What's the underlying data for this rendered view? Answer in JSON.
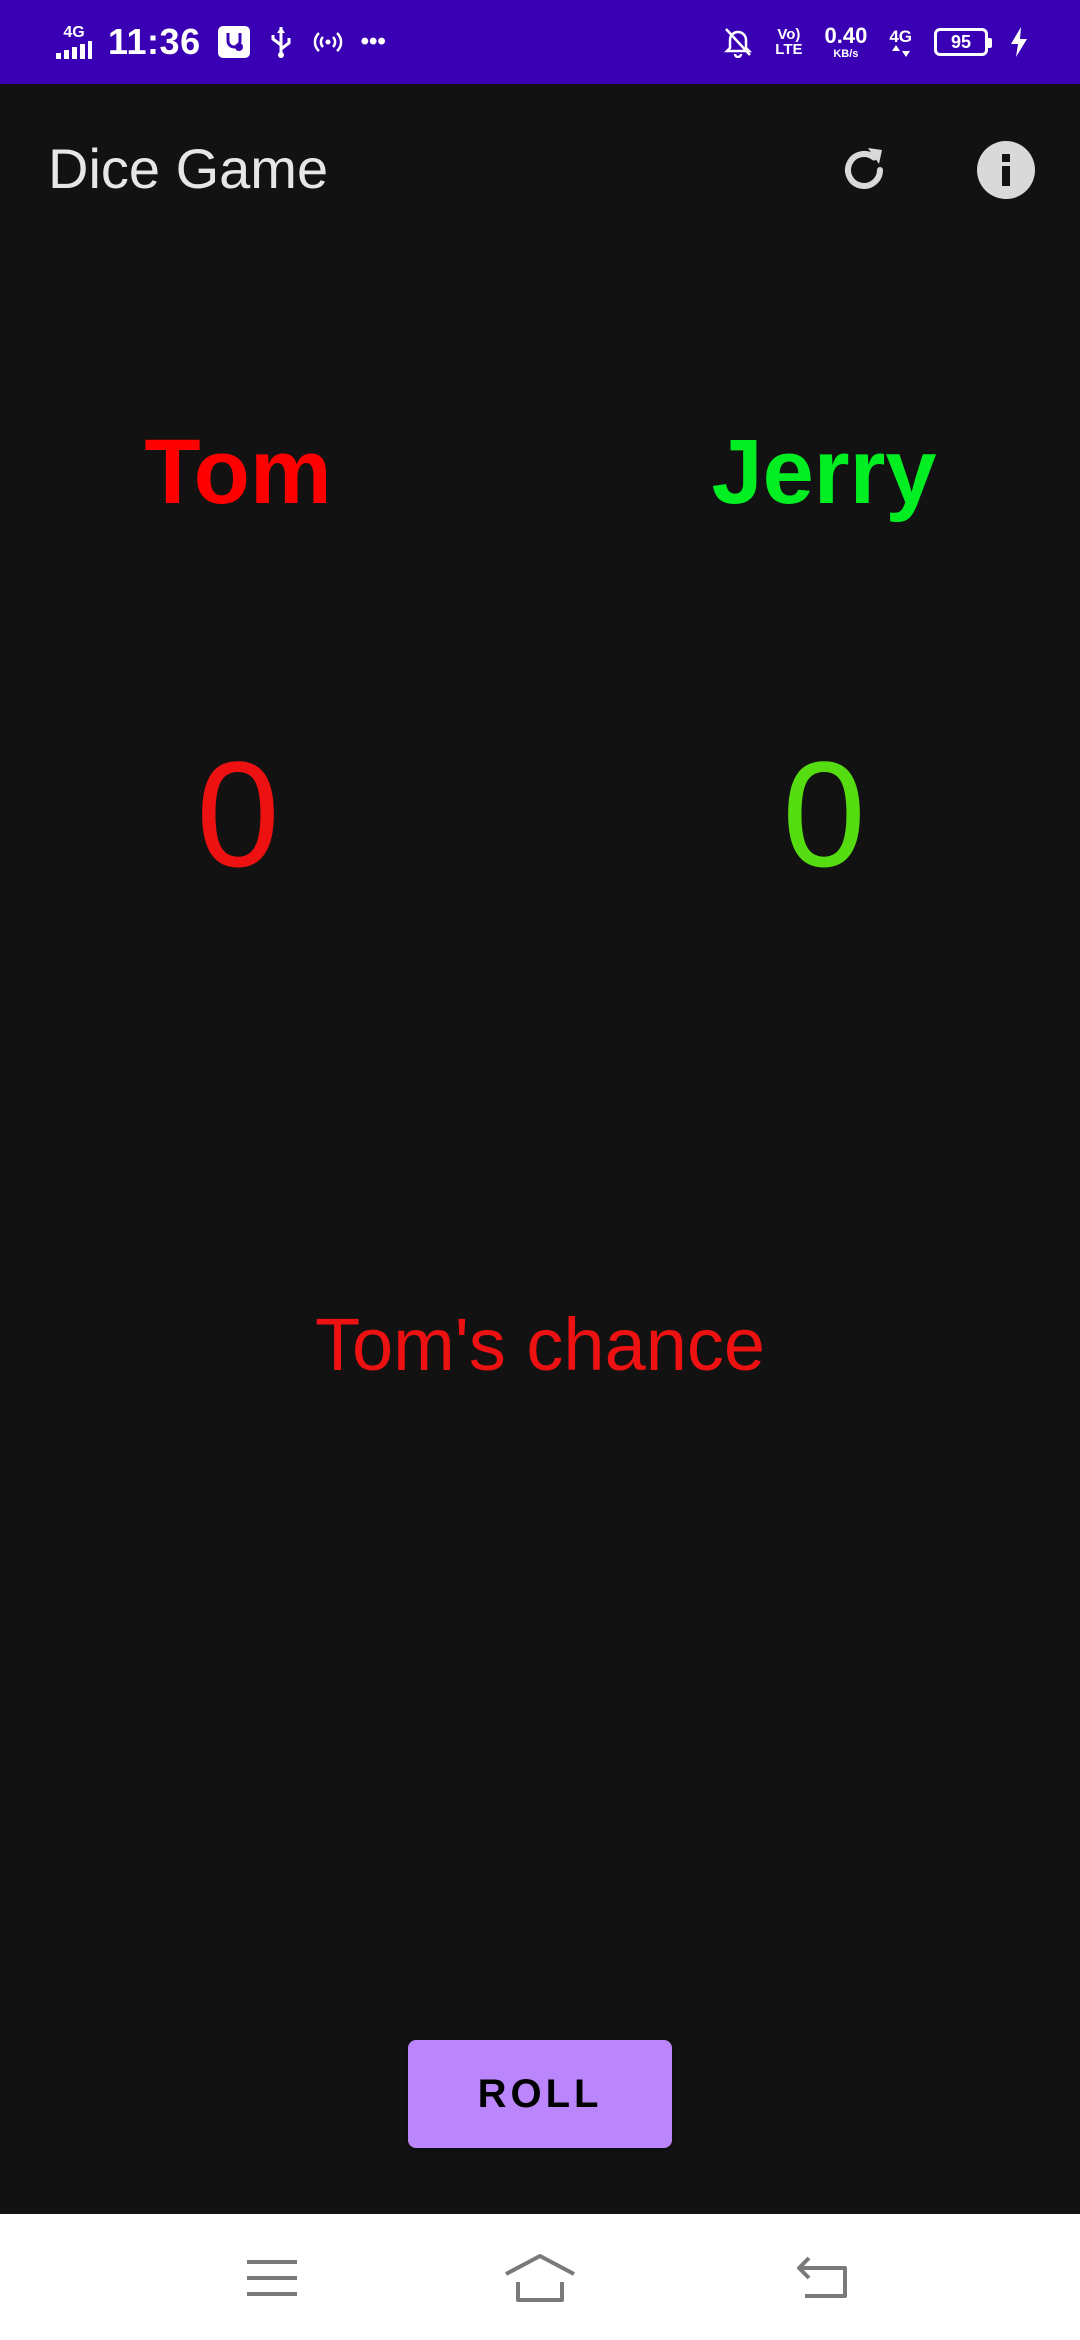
{
  "status_bar": {
    "network_left": "4G",
    "time": "11:36",
    "overflow": "•••",
    "volte_top": "Vo)",
    "volte_bottom": "LTE",
    "speed_value": "0.40",
    "speed_unit": "KB/s",
    "network_right": "4G",
    "battery_level": "95",
    "bg_color": "#3a00b4"
  },
  "app_bar": {
    "title": "Dice Game",
    "refresh_icon": "refresh-icon",
    "info_icon": "info-icon"
  },
  "players": [
    {
      "name": "Tom",
      "score": "0",
      "color": "#ff0000"
    },
    {
      "name": "Jerry",
      "score": "0",
      "color": "#00ee22"
    }
  ],
  "turn_text": "Tom's chance",
  "roll_button": {
    "label": "ROLL",
    "color": "#bb86fc"
  },
  "nav_bar": {
    "menu_icon": "menu-icon",
    "home_icon": "home-icon",
    "back_icon": "back-icon"
  }
}
